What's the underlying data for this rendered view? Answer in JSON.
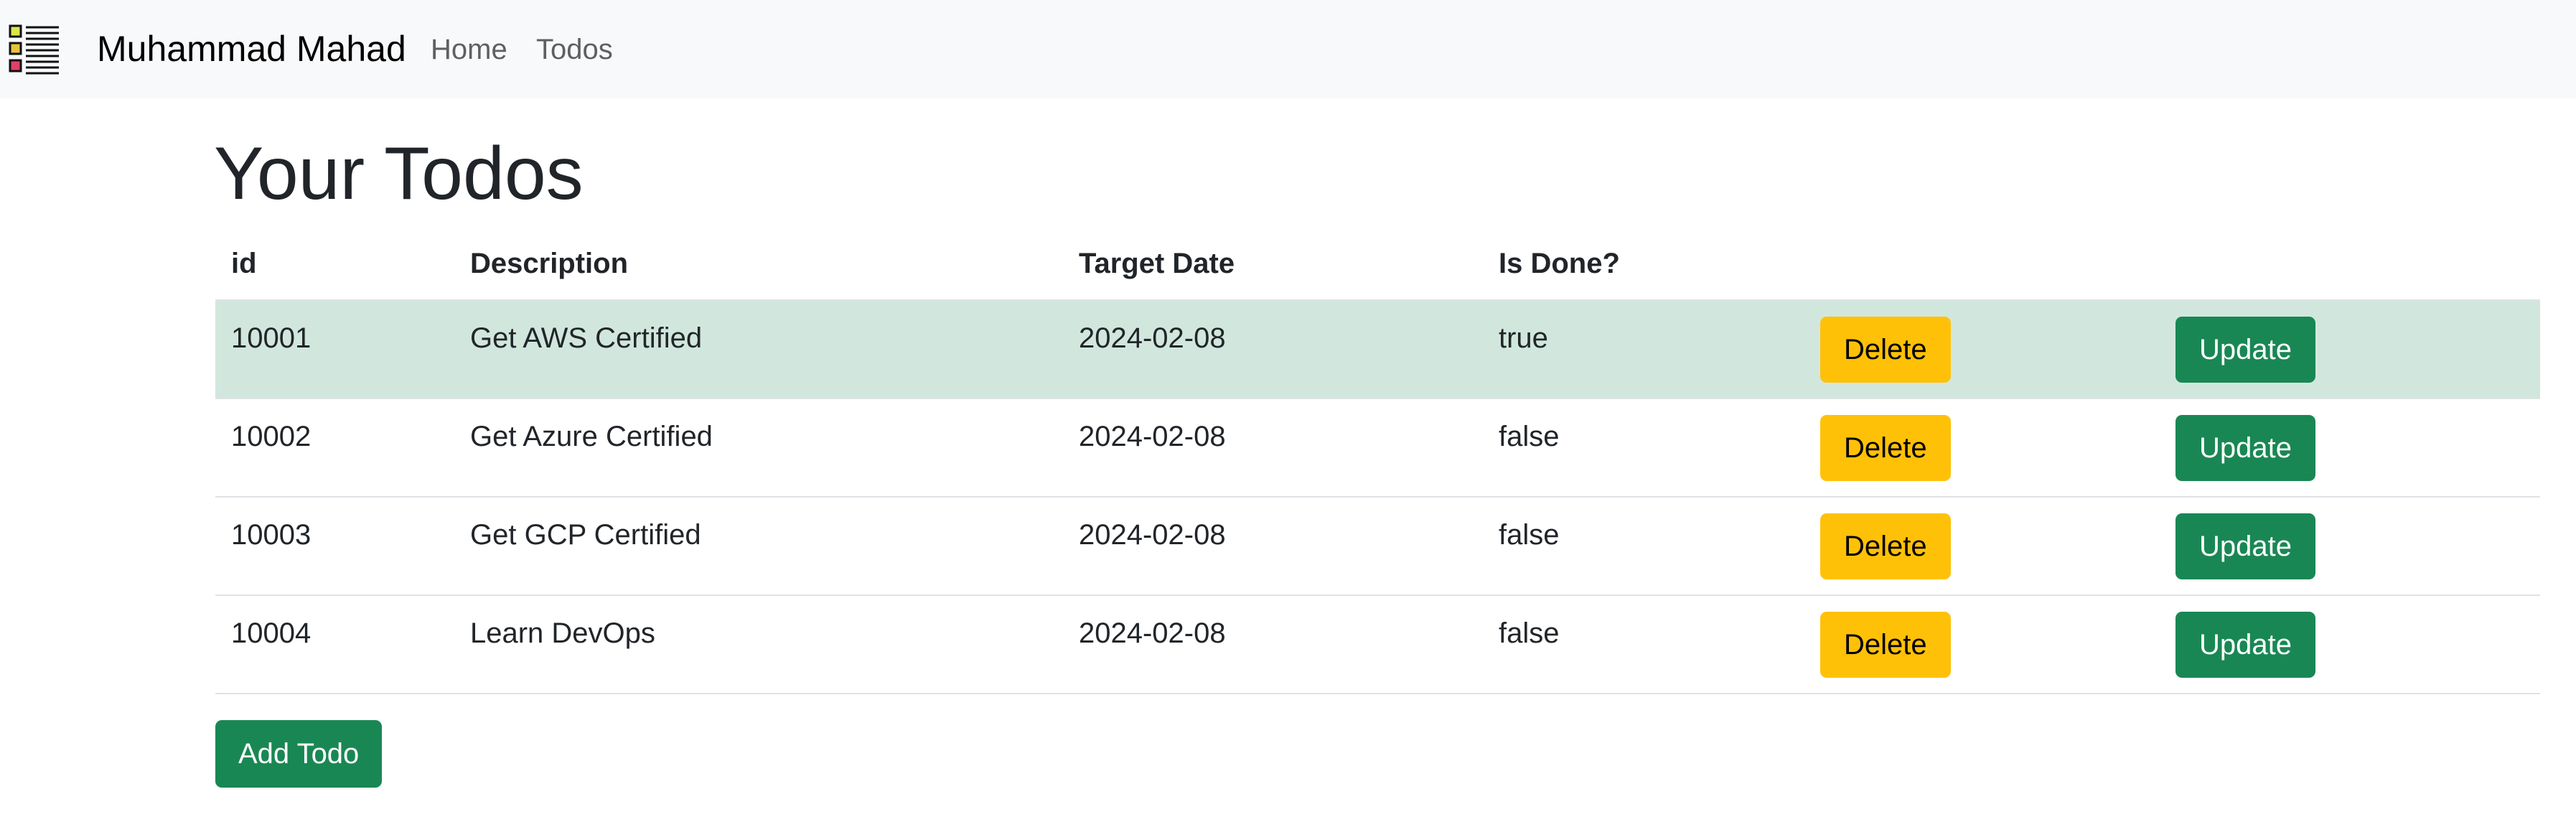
{
  "navbar": {
    "logo_icon": "todo-list-icon",
    "brand": "Muhammad Mahad",
    "links": [
      "Home",
      "Todos"
    ]
  },
  "main": {
    "title": "Your Todos",
    "table": {
      "headers": [
        "id",
        "Description",
        "Target Date",
        "Is Done?",
        "",
        ""
      ],
      "rows": [
        {
          "id": "10001",
          "description": "Get AWS Certified",
          "target_date": "2024-02-08",
          "done": "true",
          "delete_label": "Delete",
          "update_label": "Update"
        },
        {
          "id": "10002",
          "description": "Get Azure Certified",
          "target_date": "2024-02-08",
          "done": "false",
          "delete_label": "Delete",
          "update_label": "Update"
        },
        {
          "id": "10003",
          "description": "Get GCP Certified",
          "target_date": "2024-02-08",
          "done": "false",
          "delete_label": "Delete",
          "update_label": "Update"
        },
        {
          "id": "10004",
          "description": "Learn DevOps",
          "target_date": "2024-02-08",
          "done": "false",
          "delete_label": "Delete",
          "update_label": "Update"
        }
      ]
    },
    "add_button": "Add Todo"
  },
  "colors": {
    "navbar_bg": "#f8f9fa",
    "highlight_row": "#d1e7dd",
    "warning": "#ffc107",
    "success": "#198754"
  }
}
